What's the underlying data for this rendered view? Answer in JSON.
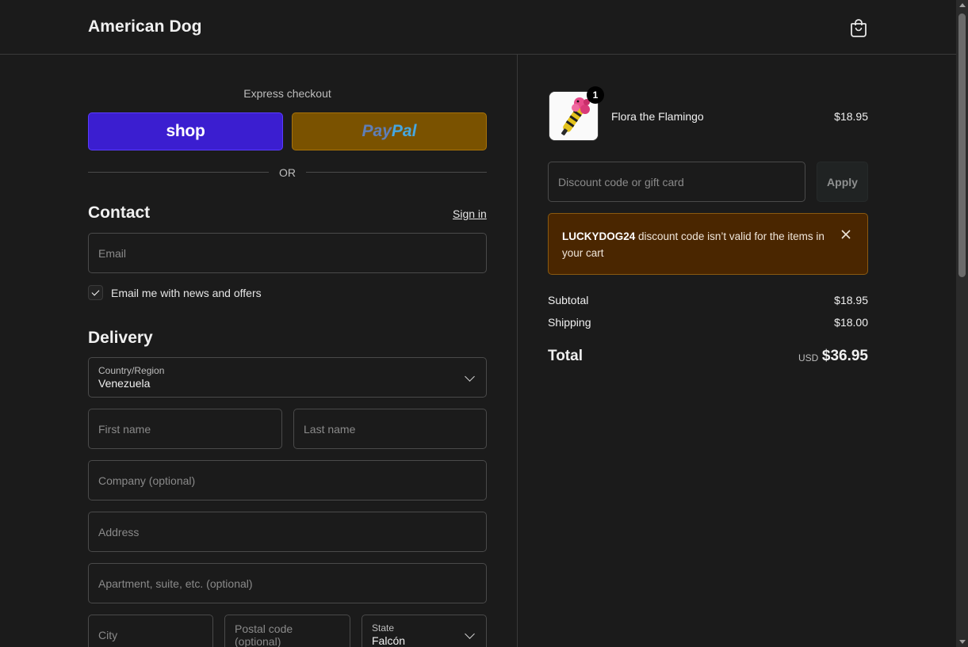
{
  "header": {
    "brand": "American Dog",
    "cart_icon": "shopping-bag-icon"
  },
  "express": {
    "label": "Express checkout",
    "shop_label": "shop",
    "paypal_label_1": "Pay",
    "paypal_label_2": "Pal",
    "or_label": "OR"
  },
  "contact": {
    "title": "Contact",
    "sign_in": "Sign in",
    "email_placeholder": "Email",
    "newsletter_label": "Email me with news and offers",
    "newsletter_checked": true
  },
  "delivery": {
    "title": "Delivery",
    "country_label": "Country/Region",
    "country_value": "Venezuela",
    "first_name_placeholder": "First name",
    "last_name_placeholder": "Last name",
    "company_placeholder": "Company (optional)",
    "address_placeholder": "Address",
    "apartment_placeholder": "Apartment, suite, etc. (optional)",
    "city_placeholder": "City",
    "postal_placeholder": "Postal code (optional)",
    "state_label": "State",
    "state_value": "Falcón"
  },
  "order": {
    "item": {
      "name": "Flora the Flamingo",
      "price": "$18.95",
      "quantity": "1"
    },
    "discount_placeholder": "Discount code or gift card",
    "apply_label": "Apply",
    "alert": {
      "code": "LUCKYDOG24",
      "message": " discount code isn’t valid for the items in your cart"
    },
    "subtotal_label": "Subtotal",
    "subtotal_value": "$18.95",
    "shipping_label": "Shipping",
    "shipping_value": "$18.00",
    "total_label": "Total",
    "total_currency": "USD",
    "total_value": "$36.95"
  },
  "colors": {
    "background": "#1b1b1b",
    "shop_pay": "#3b1ed0",
    "paypal": "#7a5200",
    "alert_bg": "#4a2600"
  }
}
